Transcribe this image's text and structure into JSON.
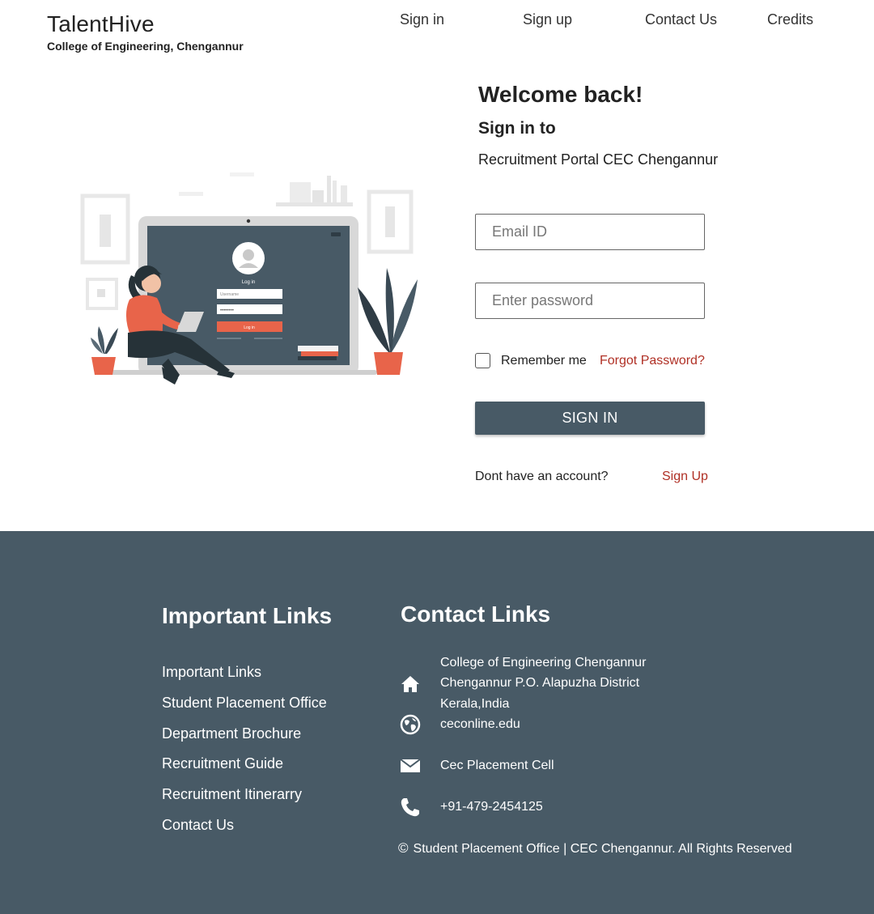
{
  "header": {
    "title": "TalentHive",
    "subtitle": "College of Engineering, Chengannur",
    "nav": {
      "signin": "Sign in",
      "signup": "Sign up",
      "contact": "Contact Us",
      "credits": "Credits"
    }
  },
  "illustration": {
    "screen_title": "Log in",
    "username_placeholder": "Username",
    "password_mask": "••••••••",
    "button": "Log in"
  },
  "form": {
    "welcome": "Welcome back!",
    "signin_to": "Sign in to",
    "portal": "Recruitment Portal CEC Chengannur",
    "email_placeholder": "Email ID",
    "password_placeholder": "Enter password",
    "remember": "Remember me",
    "forgot": "Forgot Password?",
    "button": "SIGN IN",
    "no_account": "Dont have an account?",
    "signup_link": "Sign Up"
  },
  "footer": {
    "important_heading": "Important Links",
    "links": [
      "Important Links",
      "Student Placement Office",
      "Department Brochure",
      "Recruitment Guide",
      "Recruitment Itinerarry",
      "Contact Us"
    ],
    "contact_heading": "Contact Links",
    "address": [
      "College of Engineering Chengannur",
      "Chengannur P.O. Alapuzha District",
      "Kerala,India"
    ],
    "website": "ceconline.edu",
    "email": "Cec Placement Cell",
    "phone": "+91-479-2454125",
    "copyright": "Student Placement Office | CEC Chengannur. All Rights Reserved"
  },
  "colors": {
    "primary": "#485a66",
    "accent_red": "#b03025",
    "illustration_orange": "#e8644a"
  },
  "icons": [
    "home-icon",
    "globe-icon",
    "mail-icon",
    "phone-icon",
    "copyright-icon",
    "user-icon"
  ]
}
